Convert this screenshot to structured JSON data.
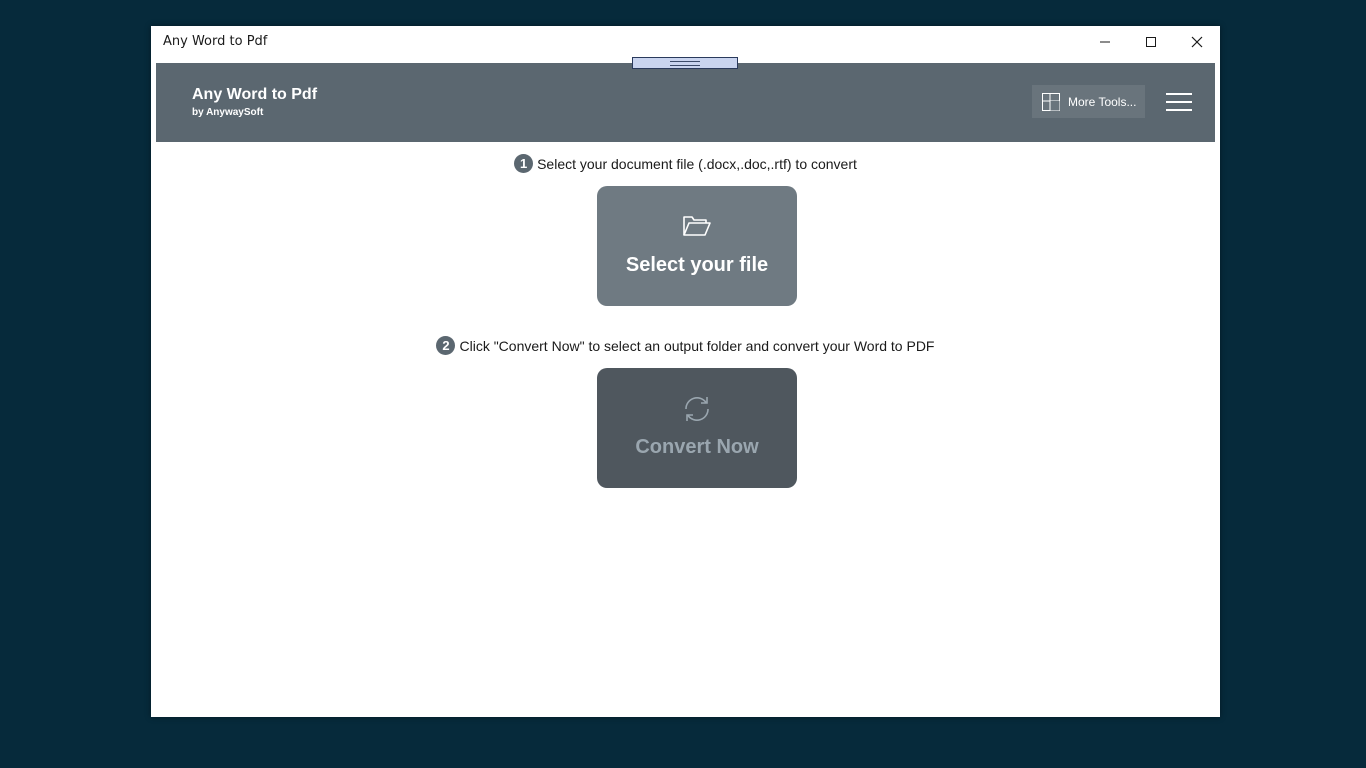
{
  "window": {
    "title": "Any Word to Pdf"
  },
  "header": {
    "app_title": "Any Word to Pdf",
    "app_subtitle": "by AnywaySoft",
    "more_tools_label": "More Tools...",
    "background_color": "#5b6770"
  },
  "steps": [
    {
      "number": "1",
      "instruction": "Select your document file (.docx,.doc,.rtf) to convert",
      "button_label": "Select your file",
      "button_icon": "folder-open-icon"
    },
    {
      "number": "2",
      "instruction": "Click \"Convert Now\" to select an output folder and convert your Word to PDF",
      "button_label": "Convert Now",
      "button_icon": "refresh-icon"
    }
  ],
  "colors": {
    "desktop": "#062a3b",
    "select_button": "#6f7a82",
    "convert_button_disabled": "#4f575e",
    "convert_label_disabled": "#9aa6af"
  }
}
